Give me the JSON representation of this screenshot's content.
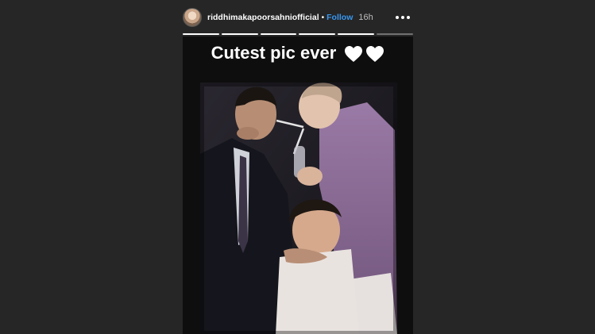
{
  "header": {
    "username": "riddhimakapoorsahniofficial",
    "separator": "•",
    "follow_label": "Follow",
    "time": "16h",
    "more_icon": "more-options-icon"
  },
  "progress": {
    "segments": 6,
    "completed": 5
  },
  "story": {
    "caption": "Cutest pic ever",
    "caption_icons": [
      "white-heart-icon",
      "white-heart-icon"
    ],
    "photo_icon": "vintage-family-photo"
  },
  "colors": {
    "background": "#262626",
    "follow": "#3897f0",
    "story_bg": "#0e0e0e",
    "heart": "#ffffff"
  }
}
